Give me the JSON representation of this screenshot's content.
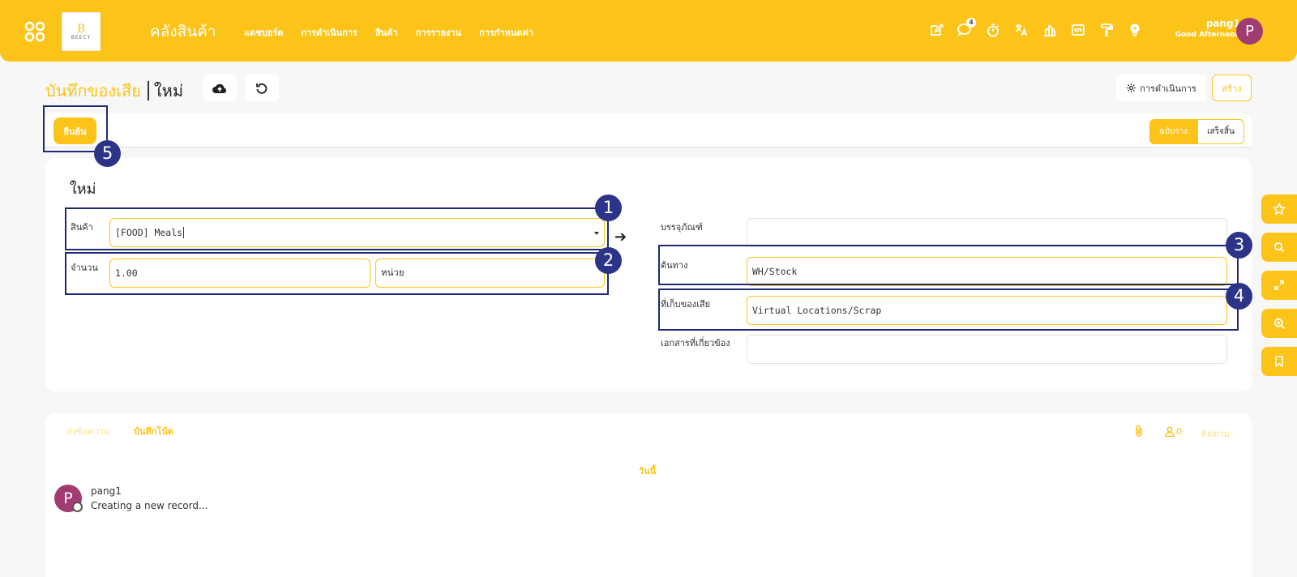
{
  "header": {
    "logo_text": "BEECY",
    "app_title": "คลังสินค้า",
    "nav": [
      "แดชบอร์ด",
      "การดำเนินการ",
      "สินค้า",
      "การรายงาน",
      "การกำหนดค่า"
    ],
    "message_badge": "4",
    "user_name": "pang1",
    "greeting": "Good Afternoon",
    "avatar_letter": "P"
  },
  "control": {
    "breadcrumb_parent": "บันทึกของเสีย",
    "breadcrumb_current": "ใหม่",
    "operations_label": "การดำเนินการ",
    "create_label": "สร้าง"
  },
  "status": {
    "confirm_label": "ยืนยัน",
    "states": [
      "ฉบับร่าง",
      "เสร็จสิ้น"
    ],
    "active_state": "ฉบับร่าง"
  },
  "form": {
    "title": "ใหม่",
    "product_label": "สินค้า",
    "product_value": "[FOOD] Meals",
    "quantity_label": "จำนวน",
    "quantity_value": "1.00",
    "uom_value": "หน่วย",
    "package_label": "บรรจุภัณฑ์",
    "package_value": "",
    "source_label": "ต้นทาง",
    "source_value": "WH/Stock",
    "scrap_location_label": "ที่เก็บของเสีย",
    "scrap_location_value": "Virtual Locations/Scrap",
    "source_document_label": "เอกสารที่เกี่ยวข้อง",
    "source_document_value": ""
  },
  "annotations": [
    "1",
    "2",
    "3",
    "4",
    "5"
  ],
  "chatter": {
    "send_message": "ส่งข้อความ",
    "log_note": "บันทึกโน้ต",
    "follower_count": "0",
    "follow_label": "ติดตาม",
    "today": "วันนี้",
    "author": "pang1",
    "author_avatar": "P",
    "message": "Creating a new record..."
  },
  "colors": {
    "accent": "#fcc419",
    "annotation": "#2c3488",
    "avatar": "#a23b72"
  }
}
